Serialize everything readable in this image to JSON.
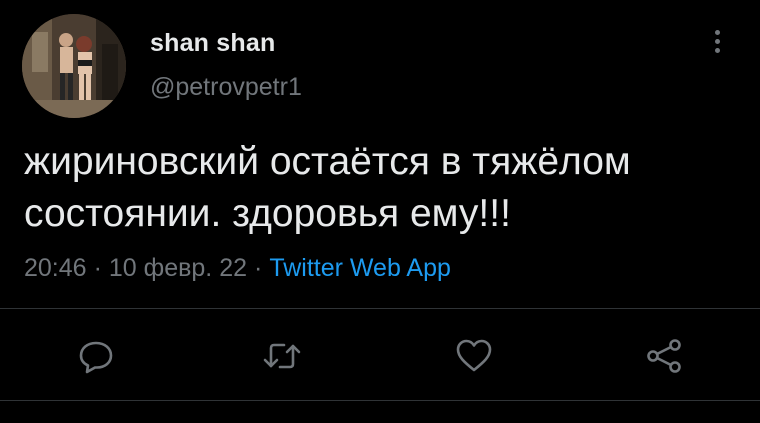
{
  "user": {
    "display_name": "shan shan",
    "username": "@petrovpetr1",
    "avatar_icon": "profile-photo-avatar"
  },
  "tweet": {
    "text": "жириновский остаётся в тяжёлом\nсостоянии. здоровья ему!!!",
    "time": "20:46",
    "date": "10 февр. 22",
    "separator": "·",
    "source": "Twitter Web App"
  },
  "actions": [
    {
      "name": "reply",
      "icon": "comment-icon"
    },
    {
      "name": "retweet",
      "icon": "retweet-icon"
    },
    {
      "name": "like",
      "icon": "heart-icon"
    },
    {
      "name": "share",
      "icon": "share-icon"
    }
  ],
  "colors": {
    "background": "#000000",
    "primary_text": "#e7e9ea",
    "secondary_text": "#71767b",
    "link": "#1d9bf0",
    "divider": "#2f3336"
  }
}
